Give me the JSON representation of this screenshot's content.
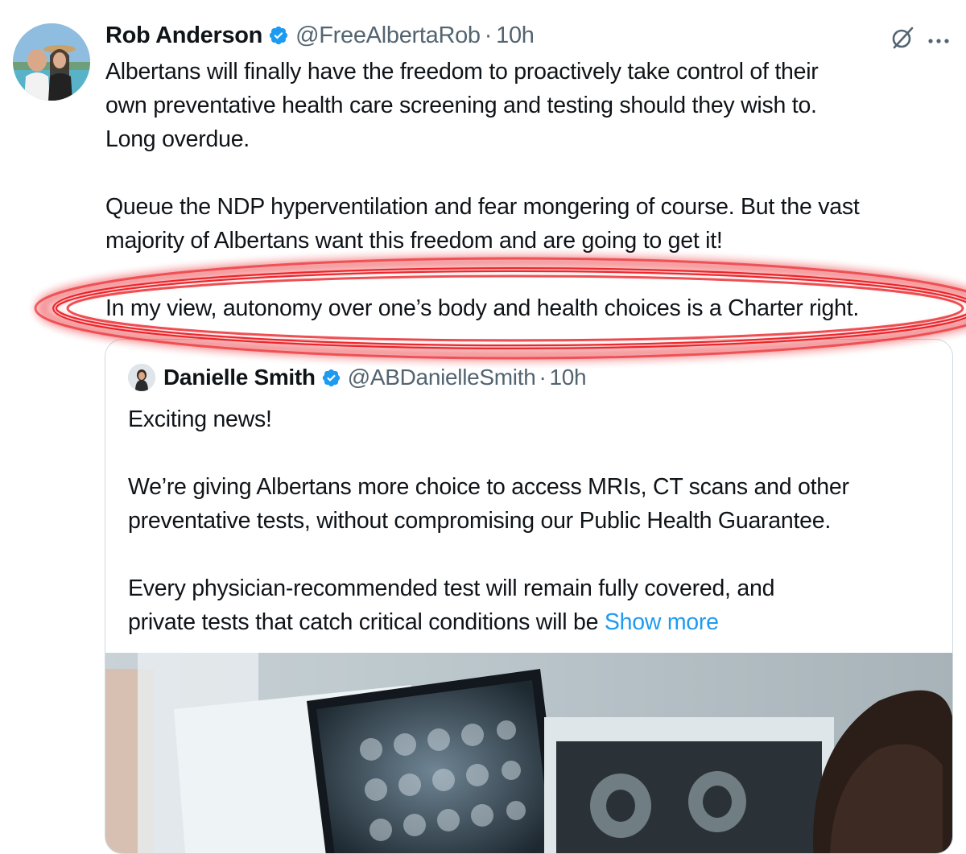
{
  "tweet": {
    "author": "Rob Anderson",
    "handle": "@FreeAlbertaRob",
    "separator": "·",
    "time": "10h",
    "paragraphs": [
      "Albertans will finally have the freedom to proactively take control of their\nown preventative health care screening and testing should they wish to.\nLong overdue.",
      "Queue the NDP hyperventilation and fear mongering of course. But the vast\nmajority of Albertans want this freedom and are going to get it!",
      "In my view, autonomy over one’s body and health choices is a Charter right."
    ],
    "icons": {
      "verified": "verified-badge-icon",
      "grok": "grok-icon",
      "more": "more-options-icon"
    }
  },
  "quote": {
    "author": "Danielle Smith",
    "handle": "@ABDanielleSmith",
    "separator": "·",
    "time": "10h",
    "paragraphs": [
      "Exciting news!",
      "We’re giving Albertans more choice to access MRIs, CT scans and other\npreventative tests, without compromising our Public Health Guarantee.",
      "Every physician-recommended test will remain fully covered, and\nprivate tests that catch critical conditions will be "
    ],
    "show_more": "Show more"
  },
  "colors": {
    "text": "#0f1419",
    "secondary": "#536471",
    "link": "#1d9bf0",
    "verified": "#1d9bf0",
    "border": "#cfd9de",
    "highlight": "#e8151b"
  }
}
